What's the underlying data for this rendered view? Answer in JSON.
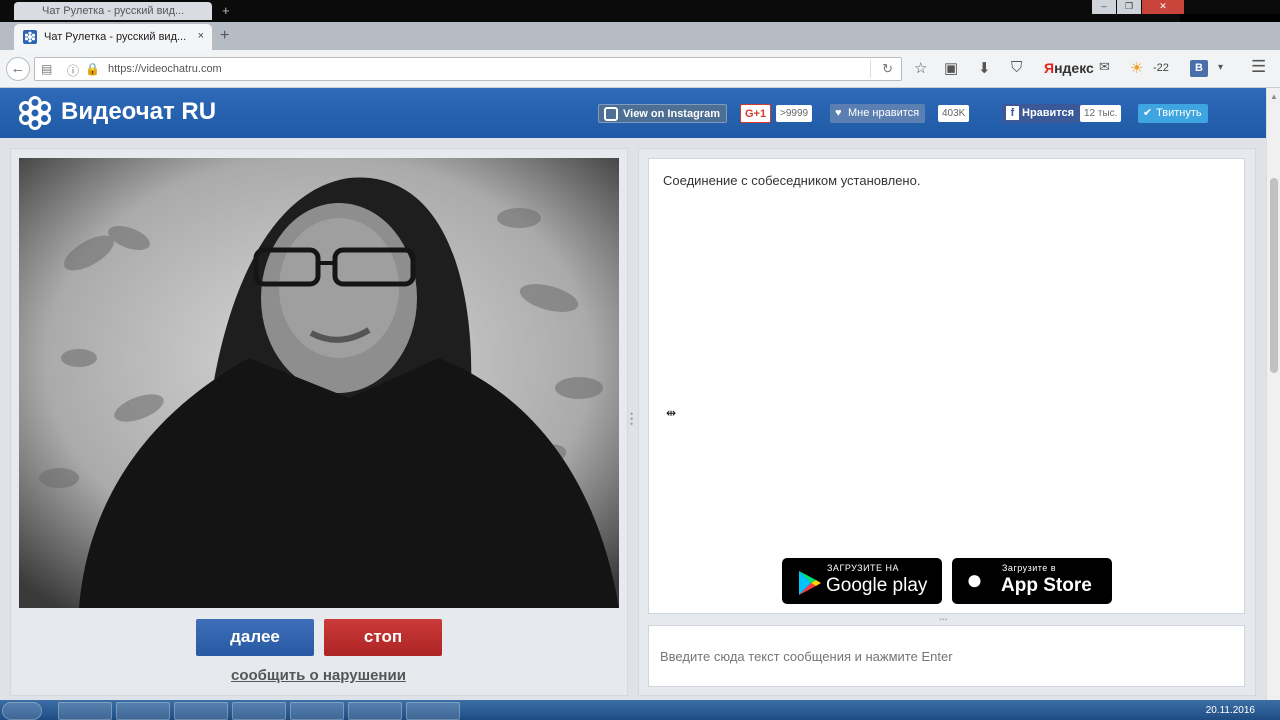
{
  "browser": {
    "ghost_tab_title": "Чат Рулетка - русский вид...",
    "tab_title": "Чат Рулетка - русский вид...",
    "tab_close": "×",
    "new_tab": "+",
    "window_controls": [
      "–",
      "❐",
      "✕"
    ],
    "url": "https://videochatru.com",
    "yandex_first": "Я",
    "yandex_rest": "ндекс",
    "weather": "-22",
    "vk_label": "В"
  },
  "site": {
    "logo_text": "Видеочат RU",
    "instagram_label": "View on Instagram",
    "gplus_label": "G+1",
    "gplus_count": ">9999",
    "like_label": "Мне нравится",
    "like_count": "403K",
    "fb_label": "Нравится",
    "fb_count": "12 тыс.",
    "tweet_label": "Твитнуть"
  },
  "video_panel": {
    "next_button": "далее",
    "stop_button": "стоп",
    "report_link": "сообщить о нарушении"
  },
  "chat": {
    "status_message": "Соединение с собеседником установлено.",
    "google_play_small": "ЗАГРУЗИТЕ НА",
    "google_play_big": "Google play",
    "app_store_small": "Загрузите в",
    "app_store_big": "App Store",
    "input_placeholder": "Введите сюда текст сообщения и нажмите Enter"
  },
  "taskbar": {
    "date": "20.11.2016"
  },
  "colors": {
    "header_blue": "#2a64b2",
    "next_blue": "#2f62ad",
    "stop_red": "#c03030"
  }
}
